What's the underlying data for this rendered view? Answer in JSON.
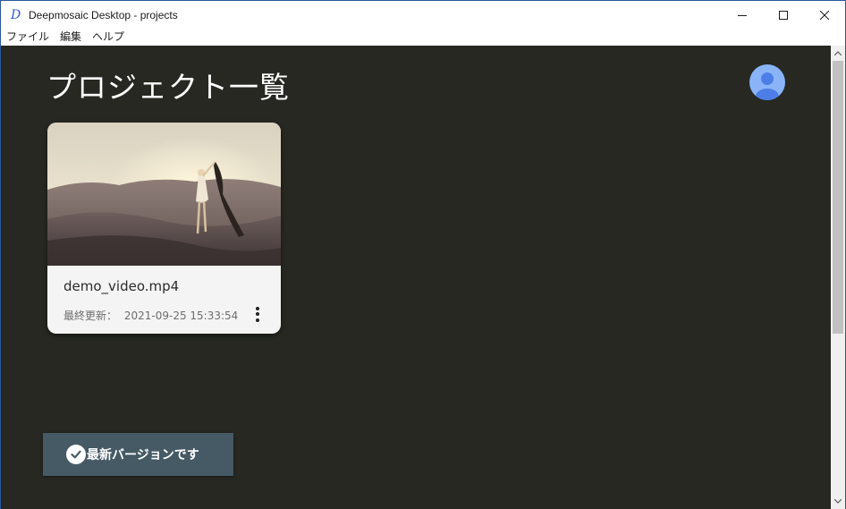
{
  "window": {
    "title": "Deepmosaic Desktop - projects",
    "logo_glyph": "D"
  },
  "menu": {
    "items": [
      "ファイル",
      "編集",
      "ヘルプ"
    ]
  },
  "page": {
    "title": "プロジェクト一覧"
  },
  "projects": [
    {
      "filename": "demo_video.mp4",
      "updated_label": "最終更新：",
      "updated_at": "2021-09-25 15:33:54"
    }
  ],
  "version_status": {
    "label": "最新バージョンです"
  },
  "colors": {
    "background": "#272822",
    "card": "#f4f4f4",
    "version_button": "#455a64",
    "avatar": "#8ab4f8",
    "avatar_figure": "#4d7ee8"
  },
  "icons": [
    "app-logo-icon",
    "minimize-icon",
    "maximize-icon",
    "close-icon",
    "user-avatar-icon",
    "more-vert-icon",
    "check-circle-icon",
    "scroll-up-icon",
    "scroll-down-icon"
  ]
}
